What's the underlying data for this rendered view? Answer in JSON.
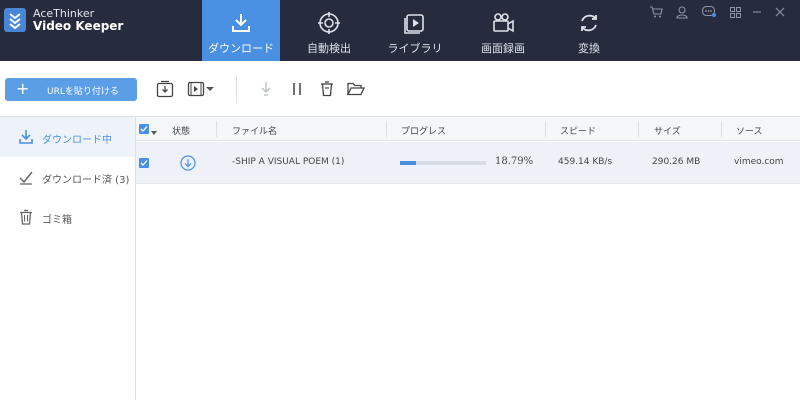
{
  "app": {
    "name_line1": "AceThinker",
    "name_line2": "Video Keeper"
  },
  "nav": {
    "tabs": [
      {
        "label": "ダウンロード",
        "icon": "download-icon",
        "active": true
      },
      {
        "label": "自動検出",
        "icon": "target-icon",
        "active": false
      },
      {
        "label": "ライブラリ",
        "icon": "video-library-icon",
        "active": false
      },
      {
        "label": "画面録画",
        "icon": "video-camera-icon",
        "active": false
      },
      {
        "label": "変換",
        "icon": "convert-icon",
        "active": false
      }
    ]
  },
  "window_controls": [
    "cart-icon",
    "user-icon",
    "chat-icon",
    "menu-grid-icon",
    "minimize-icon",
    "close-icon"
  ],
  "toolbar": {
    "paste_url_label": "URLを貼り付ける",
    "icons": [
      "batch-download-icon",
      "download-video-icon",
      "dropdown-arrow-icon",
      "start-download-icon",
      "pause-icon",
      "delete-icon",
      "open-folder-icon"
    ]
  },
  "sidebar": {
    "items": [
      {
        "label": "ダウンロード中",
        "icon": "download-icon",
        "active": true
      },
      {
        "label": "ダウンロード済 (3)",
        "icon": "check-icon",
        "active": false
      },
      {
        "label": "ゴミ箱",
        "icon": "trash-icon",
        "active": false
      }
    ]
  },
  "table": {
    "columns": [
      "状態",
      "ファイル名",
      "プログレス",
      "スピード",
      "サイズ",
      "ソース"
    ],
    "rows": [
      {
        "checked": true,
        "status_icon": "downloading-icon",
        "file_name": "-SHIP A VISUAL POEM (1)",
        "progress_text": "18.79%",
        "progress_fraction": 0.1879,
        "speed": "459.14 KB/s",
        "size": "290.26 MB",
        "source": "vimeo.com"
      }
    ]
  },
  "colors": {
    "topbar_bg": "#262c3e",
    "accent": "#4a90e2",
    "button_blue": "#5b9ee6"
  }
}
